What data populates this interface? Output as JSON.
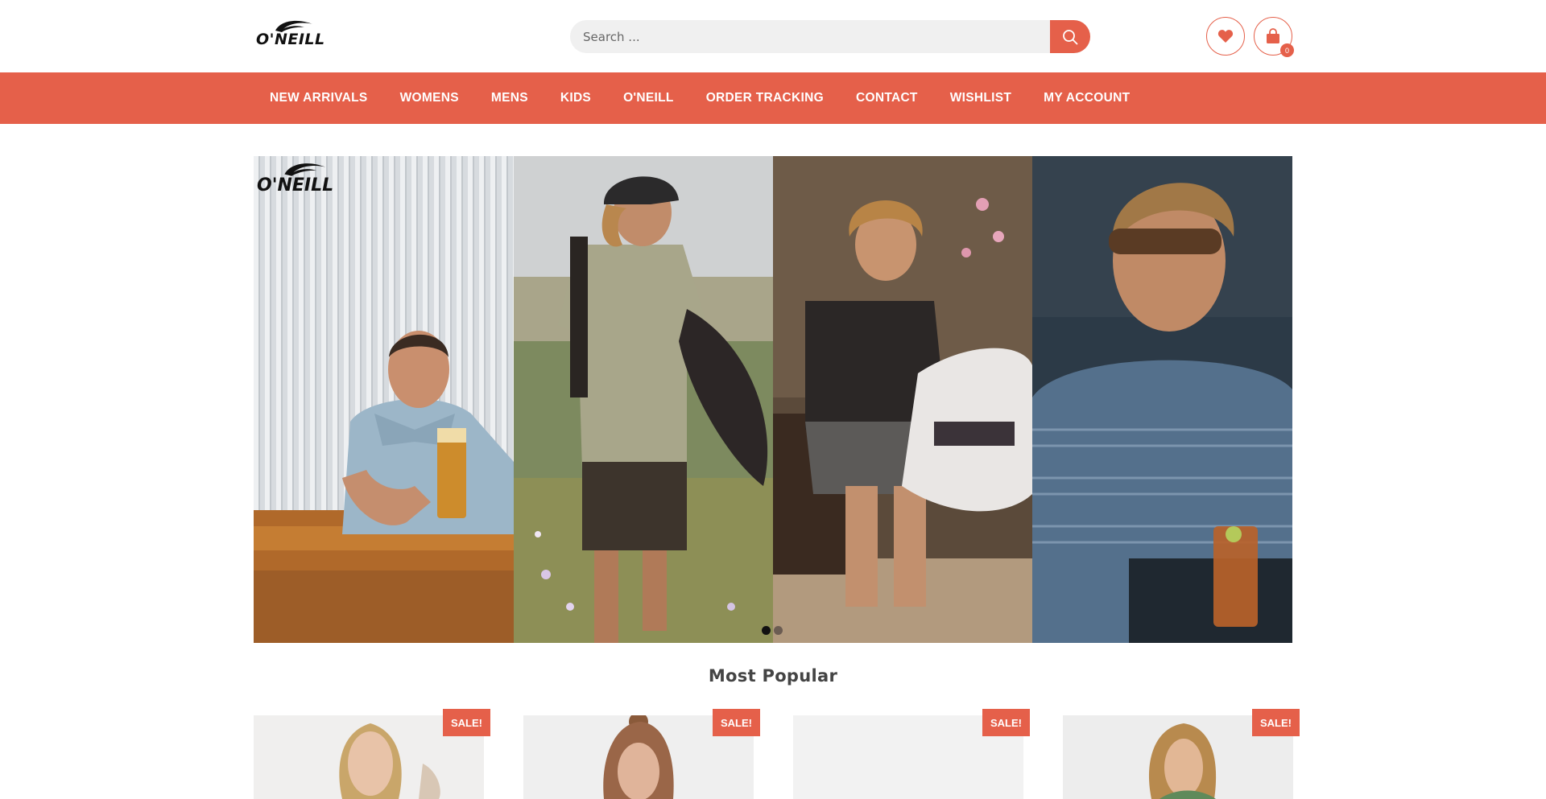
{
  "brand": {
    "logo_text": "O'NEILL"
  },
  "search": {
    "placeholder": "Search ..."
  },
  "header": {
    "cart_count": "0"
  },
  "nav": {
    "items": [
      {
        "label": "NEW ARRIVALS"
      },
      {
        "label": "WOMENS"
      },
      {
        "label": "MENS"
      },
      {
        "label": "KIDS"
      },
      {
        "label": "O'NEILL"
      },
      {
        "label": "ORDER TRACKING"
      },
      {
        "label": "CONTACT"
      },
      {
        "label": "WISHLIST"
      },
      {
        "label": "MY ACCOUNT"
      }
    ]
  },
  "hero": {
    "logo_text": "O'NEILL",
    "slide_count": 2,
    "active_slide": 1
  },
  "most_popular": {
    "title": "Most Popular",
    "products": [
      {
        "badge": "SALE!"
      },
      {
        "badge": "SALE!"
      },
      {
        "badge": "SALE!"
      },
      {
        "badge": "SALE!"
      }
    ]
  },
  "colors": {
    "accent": "#e5604a",
    "text": "#444444"
  },
  "icons": [
    "search-icon",
    "heart-icon",
    "shopping-bag-icon"
  ]
}
